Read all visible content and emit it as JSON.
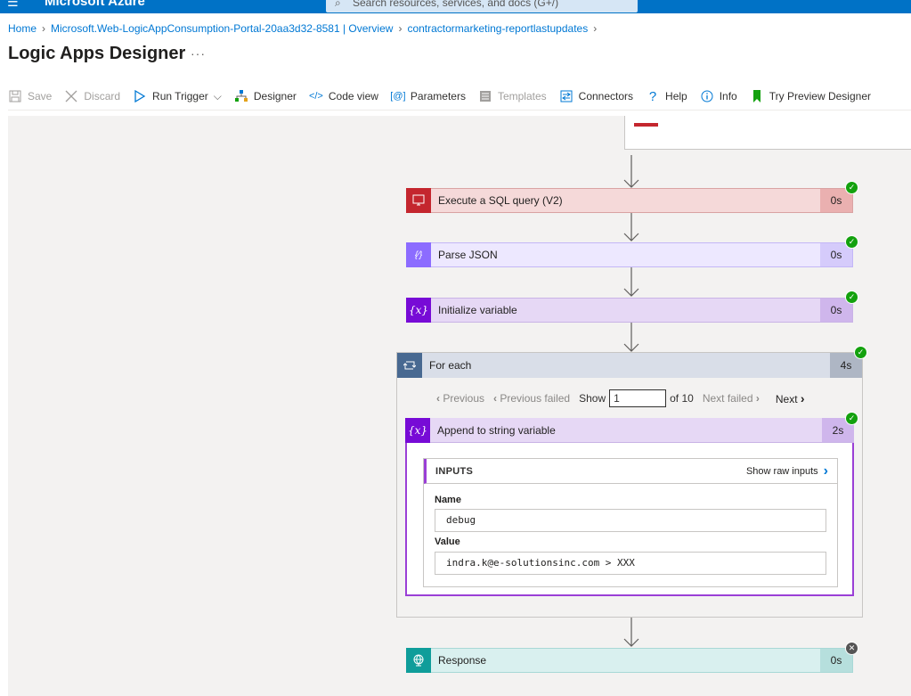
{
  "topbar": {
    "brand": "Microsoft Azure",
    "search_placeholder": "Search resources, services, and docs (G+/)"
  },
  "breadcrumb": [
    "Home",
    "Microsoft.Web-LogicAppConsumption-Portal-20aa3d32-8581 | Overview",
    "contractormarketing-reportlastupdates"
  ],
  "page": {
    "title": "Logic Apps Designer",
    "more": "···"
  },
  "toolbar": {
    "save": "Save",
    "discard": "Discard",
    "run_trigger": "Run Trigger",
    "designer": "Designer",
    "code_view": "Code view",
    "parameters": "Parameters",
    "templates": "Templates",
    "connectors": "Connectors",
    "help": "Help",
    "info": "Info",
    "preview": "Try Preview Designer"
  },
  "actions": {
    "sql": {
      "label": "Execute a SQL query (V2)",
      "duration": "0s",
      "icon": "sql-icon",
      "color": "#c4262e"
    },
    "parse": {
      "label": "Parse JSON",
      "duration": "0s",
      "icon": "json-icon",
      "color": "#8c6cff"
    },
    "initvar": {
      "label": "Initialize variable",
      "duration": "0s",
      "icon": "variable-icon",
      "color": "#770bd6"
    },
    "foreach": {
      "label": "For each",
      "duration": "4s",
      "icon": "loop-icon",
      "color": "#486991"
    },
    "append": {
      "label": "Append to string variable",
      "duration": "2s",
      "icon": "variable-icon",
      "color": "#770bd6"
    },
    "response": {
      "label": "Response",
      "duration": "0s",
      "icon": "globe-icon",
      "color": "#0f9d9a"
    }
  },
  "pager": {
    "previous": "Previous",
    "previous_failed": "Previous failed",
    "show": "Show",
    "current": "1",
    "of": "of 10",
    "next_failed": "Next failed",
    "next": "Next"
  },
  "inputs": {
    "title": "INPUTS",
    "show_raw": "Show raw inputs",
    "name_label": "Name",
    "name_value": "debug",
    "value_label": "Value",
    "value_value": "indra.k@e-solutionsinc.com > XXX"
  }
}
